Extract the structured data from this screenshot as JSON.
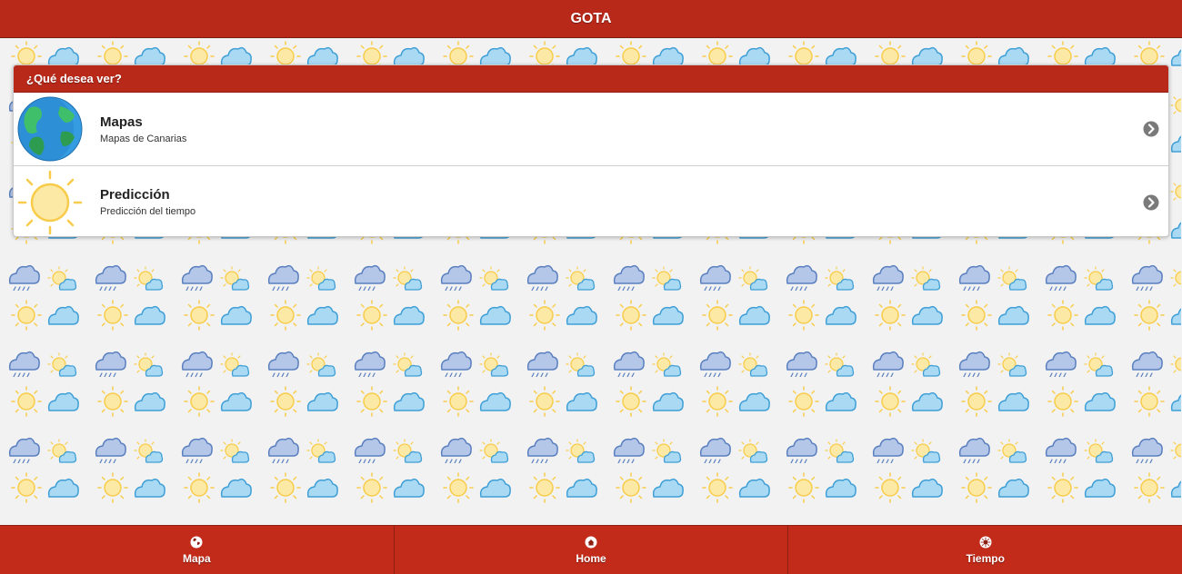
{
  "header": {
    "title": "GOTA"
  },
  "menu": {
    "title": "¿Qué desea ver?",
    "items": [
      {
        "title": "Mapas",
        "subtitle": "Mapas de Canarias",
        "icon": "globe-icon"
      },
      {
        "title": "Predicción",
        "subtitle": "Predicción del tiempo",
        "icon": "sun-icon"
      }
    ]
  },
  "footer": {
    "tabs": [
      {
        "label": "Mapa",
        "icon": "globe-icon"
      },
      {
        "label": "Home",
        "icon": "home-icon"
      },
      {
        "label": "Tiempo",
        "icon": "sun-icon"
      }
    ]
  },
  "colors": {
    "brand_red": "#b8291a",
    "sun": "#fbd86a",
    "cloud": "#a8d8f2",
    "rain_cloud": "#b8c9e6"
  }
}
